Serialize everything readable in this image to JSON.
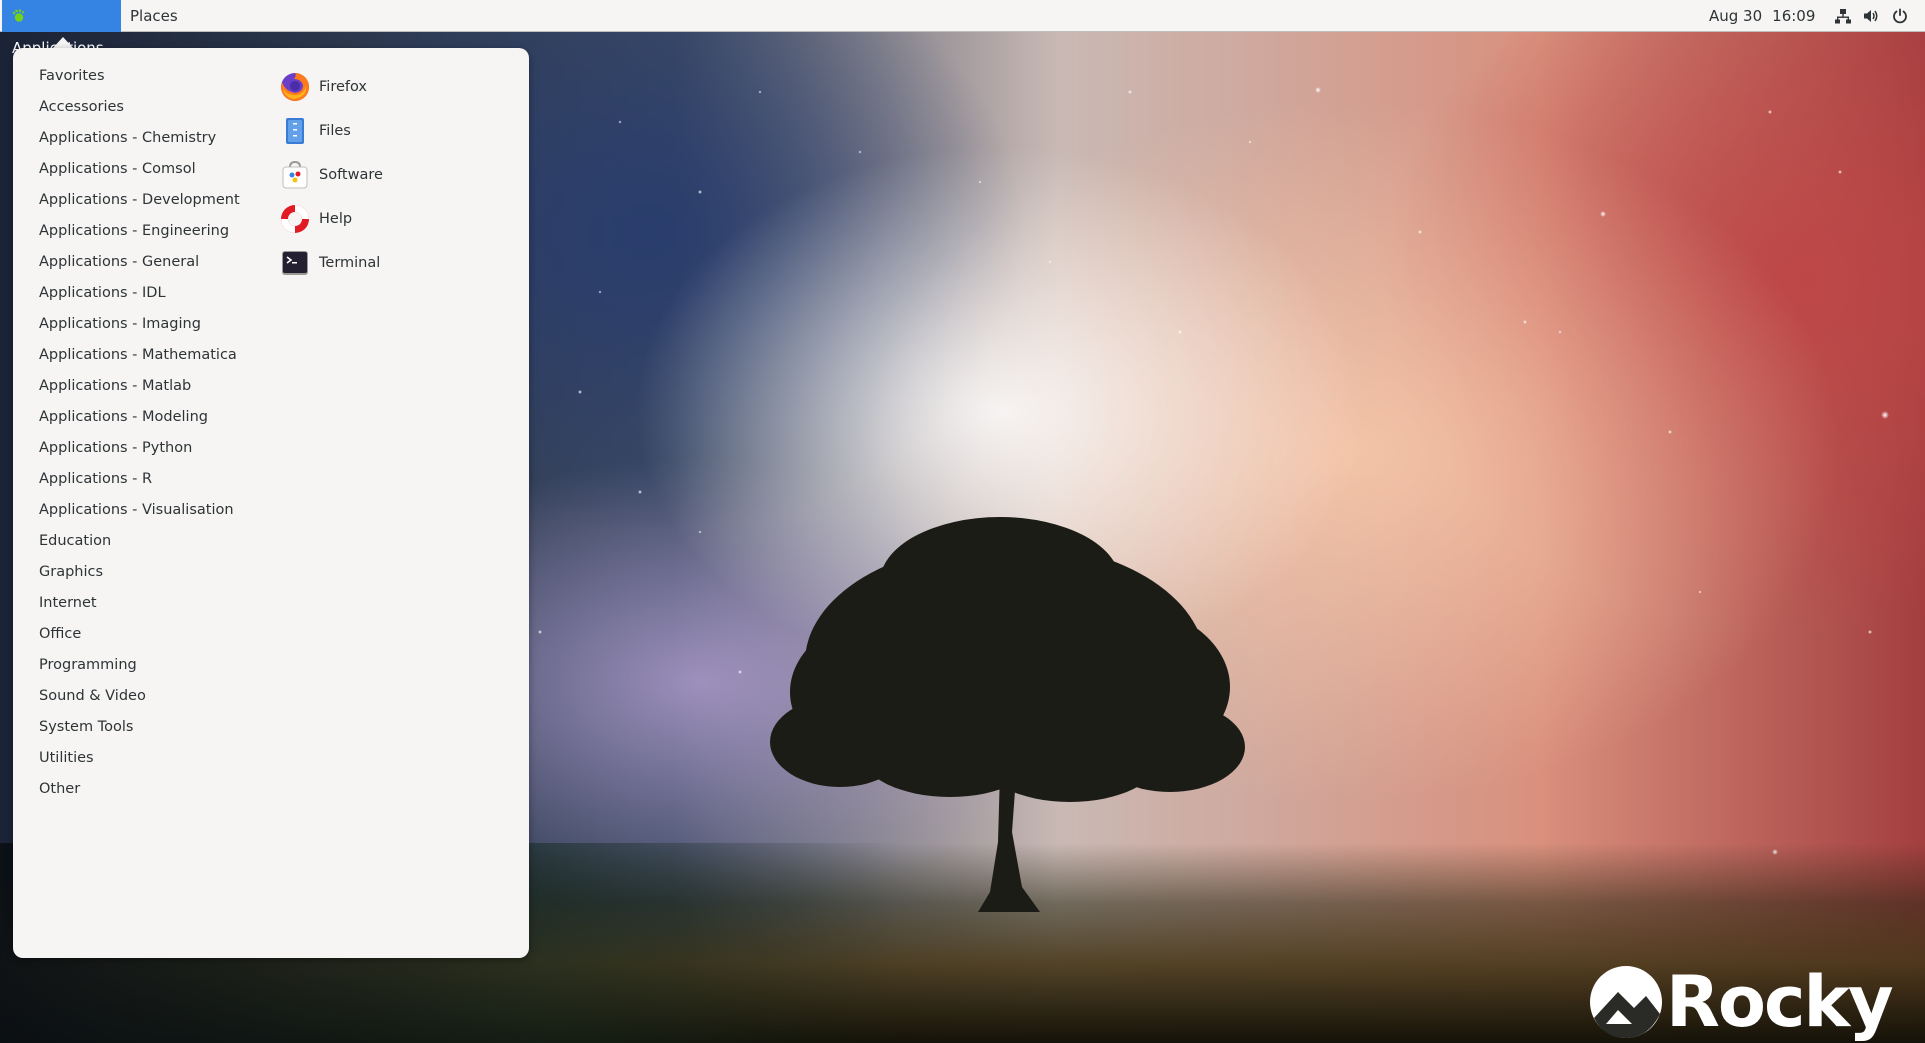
{
  "topbar": {
    "applications_label": "Applications",
    "places_label": "Places",
    "date": "Aug 30",
    "time": "16:09",
    "icons": [
      "network-icon",
      "volume-icon",
      "power-icon"
    ]
  },
  "menu": {
    "categories": [
      "Favorites",
      "Accessories",
      "Applications - Chemistry",
      "Applications - Comsol",
      "Applications - Development",
      "Applications - Engineering",
      "Applications - General",
      "Applications - IDL",
      "Applications - Imaging",
      "Applications - Mathematica",
      "Applications - Matlab",
      "Applications - Modeling",
      "Applications - Python",
      "Applications - R",
      "Applications - Visualisation",
      "Education",
      "Graphics",
      "Internet",
      "Office",
      "Programming",
      "Sound & Video",
      "System Tools",
      "Utilities",
      "Other"
    ],
    "apps": [
      {
        "label": "Firefox",
        "icon": "firefox-icon"
      },
      {
        "label": "Files",
        "icon": "files-icon"
      },
      {
        "label": "Software",
        "icon": "software-icon"
      },
      {
        "label": "Help",
        "icon": "help-icon"
      },
      {
        "label": "Terminal",
        "icon": "terminal-icon"
      }
    ]
  },
  "desktop": {
    "logo_text": "Rocky"
  },
  "colors": {
    "accent": "#3584e4",
    "panel": "#f6f5f4",
    "text": "#2e3436"
  }
}
